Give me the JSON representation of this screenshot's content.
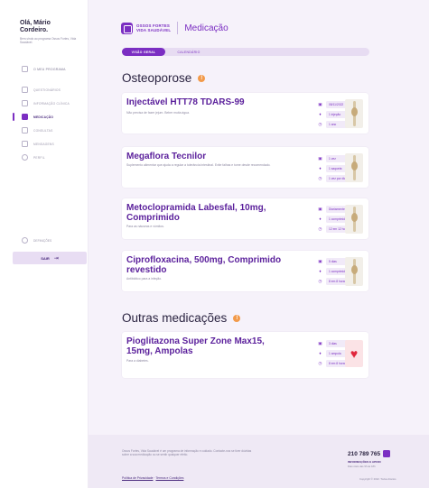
{
  "sidebar": {
    "greeting": "Olá, Mário",
    "name": "Cordeiro.",
    "subtitle": "Bem-vindo ao programa Ossos Fortes, Vida Saudável.",
    "program_label": "O MEU PROGRAMA",
    "items": [
      {
        "label": "QUESTIONÁRIOS",
        "active": false
      },
      {
        "label": "INFORMAÇÃO CLÍNICA",
        "active": false
      },
      {
        "label": "MEDICAÇÃO",
        "active": true
      },
      {
        "label": "CONSULTAS",
        "active": false
      },
      {
        "label": "MENSAGENS",
        "active": false
      },
      {
        "label": "PERFIL",
        "active": false
      }
    ],
    "settings_label": "DEFINIÇÕES",
    "logout_label": "SAIR",
    "logout_icon": "logout-arrow-icon"
  },
  "header": {
    "brand_line1": "OSSOS FORTES",
    "brand_line2": "VIDA SAUDÁVEL",
    "title": "Medicação"
  },
  "tabs": [
    "VISÃO GERAL",
    "CALENDÁRIO"
  ],
  "sections": {
    "osteoporose": "Osteoporose",
    "outras": "Outras medicações"
  },
  "cards": [
    {
      "name": "Injectável HTT78 TDARS-99",
      "desc": "Não precisa de fazer jejum. Beber muita água.",
      "info": [
        "08/11/2022",
        "1 injeção",
        "1 ano"
      ]
    },
    {
      "name": "Megaflora Tecnilor",
      "desc": "Suplemento alimentar que ajuda a regular a tolerância intestinal. Evite falhas e tome desde recomendado.",
      "info": [
        "1 vez",
        "1 saqueta",
        "1 vez por dia"
      ]
    },
    {
      "name": "Metoclopramida Labesfal, 10mg, Comprimido",
      "desc": "Para as náuseas e vómitos.",
      "info": [
        "Diariamente",
        "1 comprimido",
        "12 em 12 horas"
      ]
    },
    {
      "name": "Ciprofloxacina, 500mg, Comprimido revestido",
      "desc": "Antibiótico para a infeção.",
      "info": [
        "5 dias",
        "1 comprimido",
        "8 em 8 horas"
      ]
    },
    {
      "name": "Pioglitazona Super Zone Max15, 15mg, Ampolas",
      "desc": "Para a diabetes.",
      "info": [
        "3 dias",
        "1 ampola",
        "8 em 8 horas"
      ]
    }
  ],
  "footer": {
    "text": "Ossos Fortes, Vida Saudável é um programa de informação e cuidado. Contacte-nos se tiver dúvidas sobre a sua medicação ou se sentir qualquer efeito.",
    "link1": "Política de Privacidade",
    "separator": "·",
    "link2": "Termos e Condições",
    "phone": "210 789 765",
    "phone_info": "INFORMAÇÕES E APOIO",
    "phone_sub": "Dias úteis das 9h às 18h",
    "copyright": "Copyright © 2022. Todos direitos"
  },
  "colors": {
    "accent": "#7b2ec2",
    "title_text": "#5a1f9b",
    "background_main": "#f6f2fa",
    "badge_orange": "#f29a4a"
  }
}
